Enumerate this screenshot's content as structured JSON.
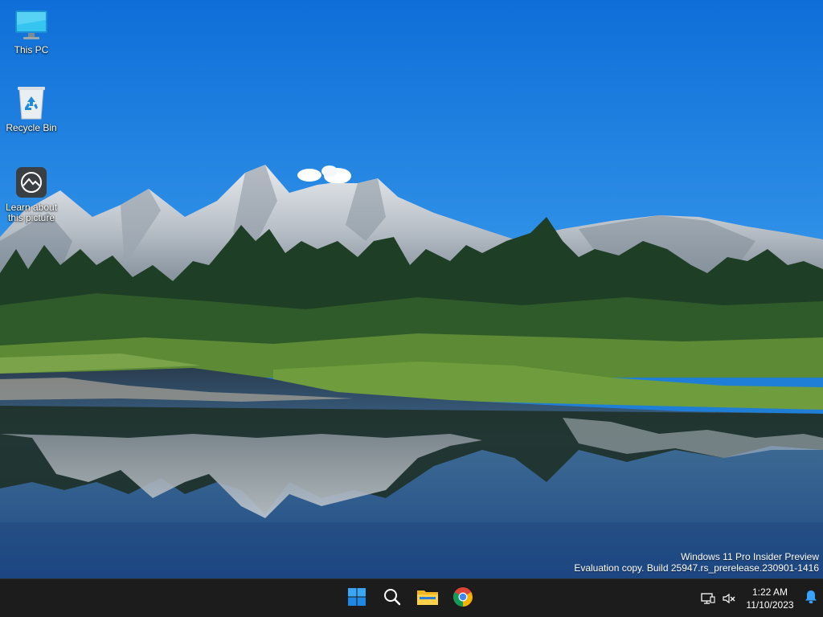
{
  "desktop": {
    "icons": [
      {
        "label": "This PC",
        "icon": "monitor-icon"
      },
      {
        "label": "Recycle Bin",
        "icon": "recycle-bin-icon"
      },
      {
        "label": "Learn about this picture",
        "icon": "learn-picture-icon"
      }
    ],
    "wallpaper": {
      "subject": "mountain-lake-wallpaper"
    }
  },
  "watermark": {
    "line1": "Windows 11 Pro Insider Preview",
    "line2": "Evaluation copy. Build 25947.rs_prerelease.230901-1416"
  },
  "taskbar": {
    "apps": [
      {
        "name": "start",
        "icon": "windows-start-icon"
      },
      {
        "name": "search",
        "icon": "search-icon"
      },
      {
        "name": "file-explorer",
        "icon": "folder-icon"
      },
      {
        "name": "chrome",
        "icon": "chrome-icon"
      }
    ],
    "tray": {
      "icons": [
        "network-icon",
        "speaker-muted-icon"
      ],
      "time": "1:22 AM",
      "date": "11/10/2023",
      "notification_icon": "bell-icon"
    },
    "colors": {
      "background": "#1c1c1c",
      "start_accent": "#1e90ff",
      "notification": "#3aa0ff"
    }
  }
}
